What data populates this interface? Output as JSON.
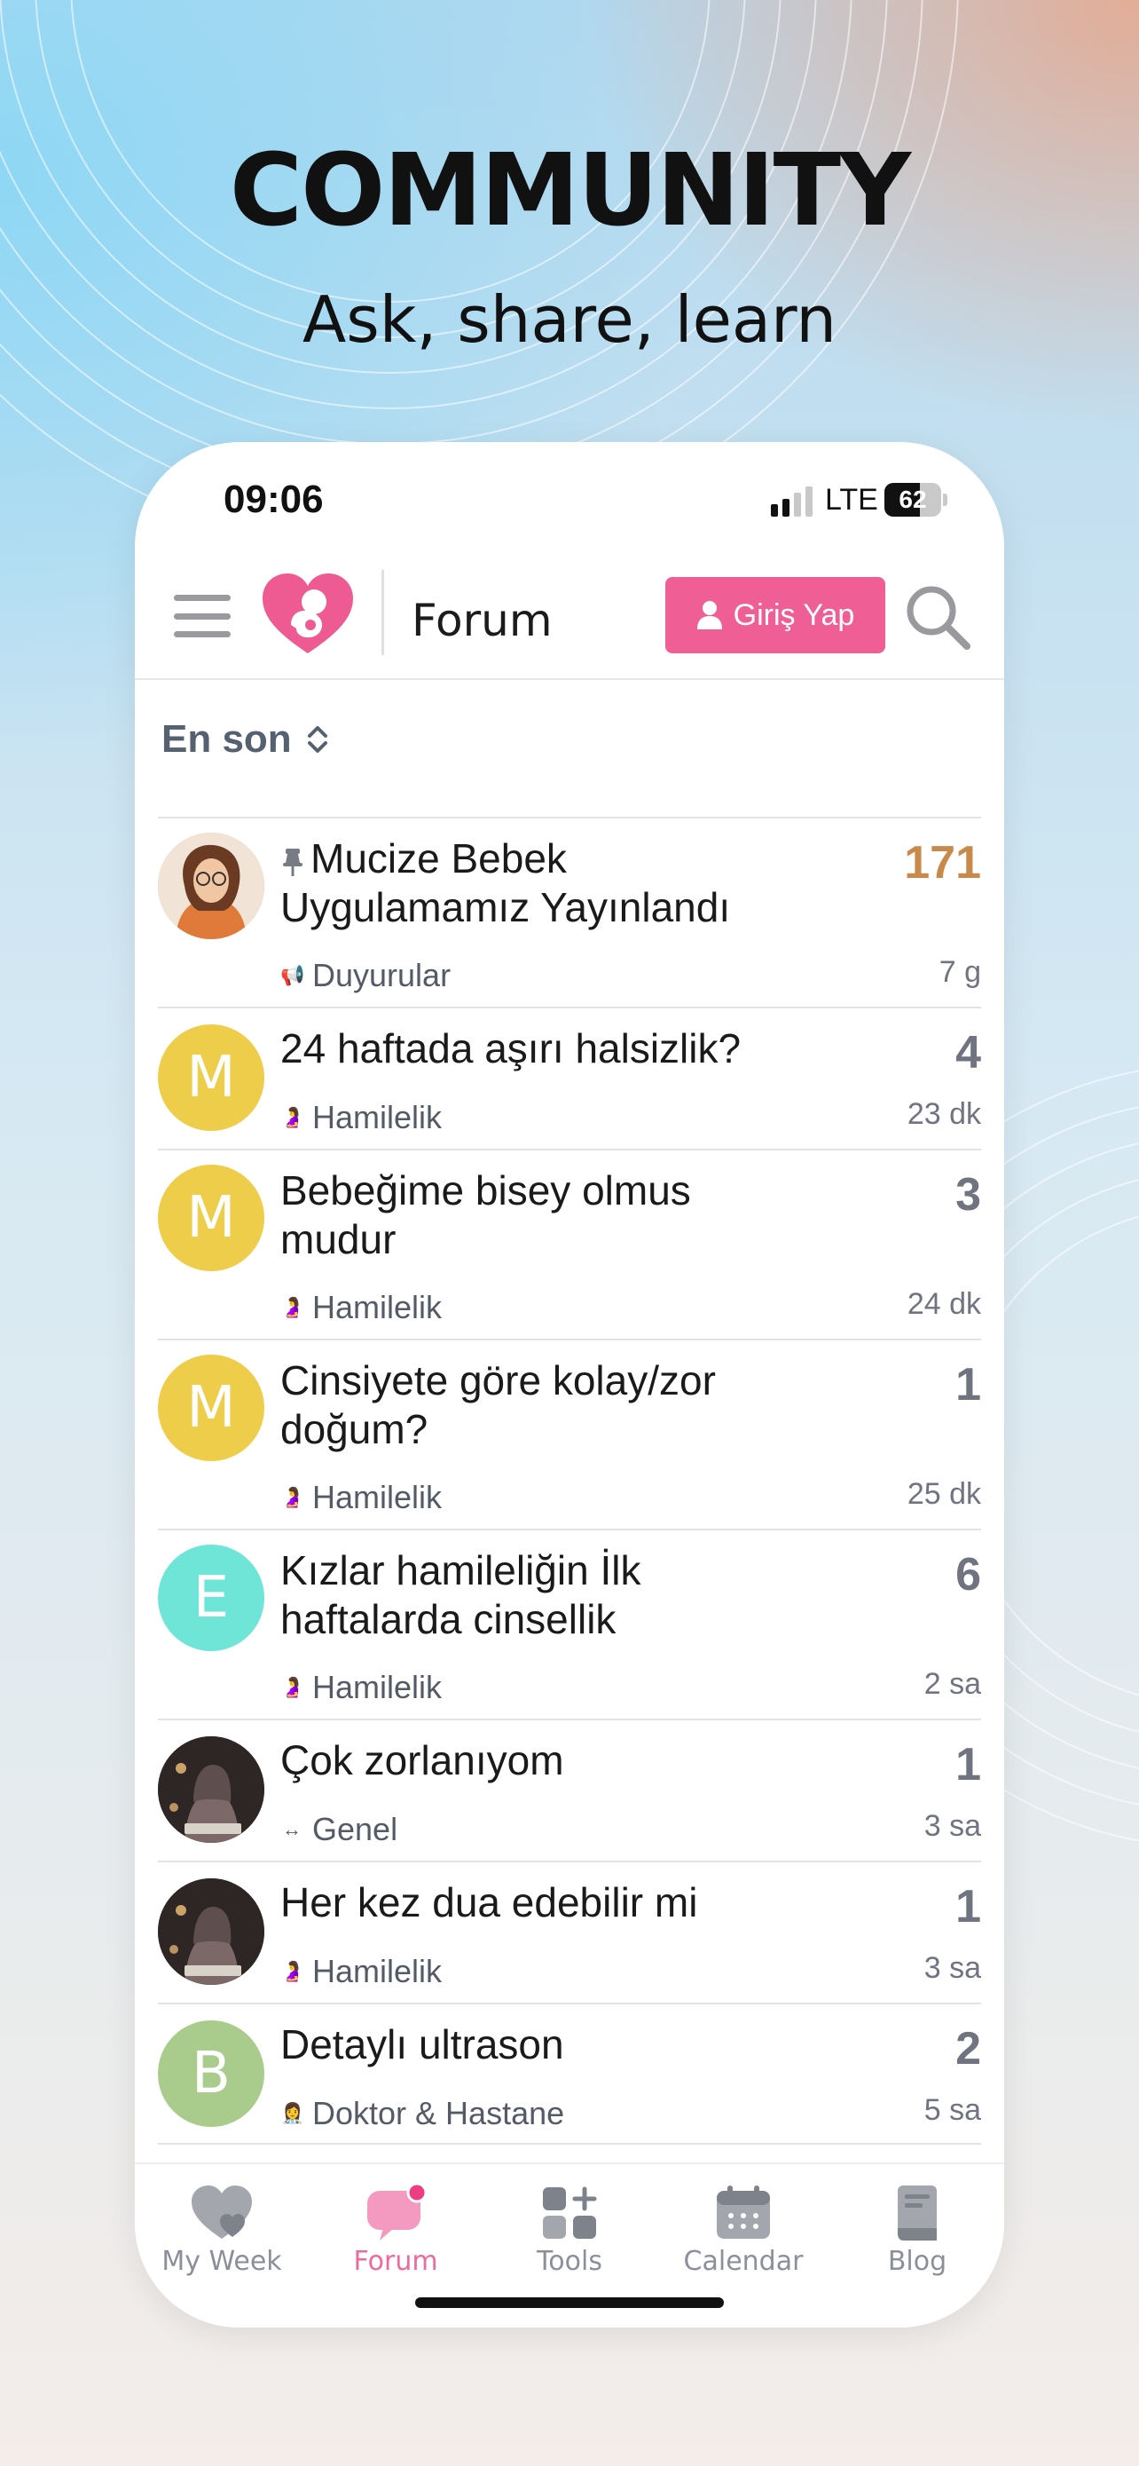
{
  "promo": {
    "headline": "COMMUNITY",
    "subline": "Ask, share, learn"
  },
  "status_bar": {
    "time": "09:06",
    "network": "LTE",
    "battery": "62",
    "battery_level": 0.62,
    "signal_bars_filled": 2,
    "signal_bars_total": 4
  },
  "app_bar": {
    "title": "Forum",
    "login_label": "Giriş Yap",
    "icons": [
      "hamburger-menu-icon",
      "heart-baby-logo",
      "user-icon",
      "search-icon"
    ]
  },
  "sort": {
    "label": "En son",
    "icon": "sort-updown-icon"
  },
  "topics": [
    {
      "avatar_type": "photo",
      "avatar_letter": "",
      "avatar_color": "#d9a07a",
      "pinned": true,
      "title": "Mucize Bebek Uygulamamız Yayınlandı",
      "category": "Duyurular",
      "category_icon": "📢",
      "count": "171",
      "age": "7 g",
      "hot": true
    },
    {
      "avatar_type": "letter",
      "avatar_letter": "M",
      "avatar_color": "#eecd4b",
      "pinned": false,
      "title": "24 haftada aşırı halsizlik?",
      "category": "Hamilelik",
      "category_icon": "🤰",
      "count": "4",
      "age": "23 dk",
      "hot": false
    },
    {
      "avatar_type": "letter",
      "avatar_letter": "M",
      "avatar_color": "#eecd4b",
      "pinned": false,
      "title": "Bebeğime bisey olmus mudur",
      "category": "Hamilelik",
      "category_icon": "🤰",
      "count": "3",
      "age": "24 dk",
      "hot": false
    },
    {
      "avatar_type": "letter",
      "avatar_letter": "M",
      "avatar_color": "#eecd4b",
      "pinned": false,
      "title": "Cinsiyete göre kolay/zor doğum?",
      "category": "Hamilelik",
      "category_icon": "🤰",
      "count": "1",
      "age": "25 dk",
      "hot": false
    },
    {
      "avatar_type": "letter",
      "avatar_letter": "E",
      "avatar_color": "#6fe5d8",
      "pinned": false,
      "title": "Kızlar hamileliğin İlk haftalarda cinsellik",
      "category": "Hamilelik",
      "category_icon": "🤰",
      "count": "6",
      "age": "2 sa",
      "hot": false
    },
    {
      "avatar_type": "photo",
      "avatar_letter": "",
      "avatar_color": "#5a4a4a",
      "pinned": false,
      "title": "Çok zorlanıyom",
      "category": "Genel",
      "category_icon": "↔",
      "count": "1",
      "age": "3 sa",
      "hot": false
    },
    {
      "avatar_type": "photo",
      "avatar_letter": "",
      "avatar_color": "#5a4a4a",
      "pinned": false,
      "title": "Her kez dua edebilir mi",
      "category": "Hamilelik",
      "category_icon": "🤰",
      "count": "1",
      "age": "3 sa",
      "hot": false
    },
    {
      "avatar_type": "letter",
      "avatar_letter": "B",
      "avatar_color": "#a9cc8c",
      "pinned": false,
      "title": "Detaylı ultrason",
      "category": "Doktor & Hastane",
      "category_icon": "👩‍⚕️",
      "count": "2",
      "age": "5 sa",
      "hot": false
    }
  ],
  "tabs": [
    {
      "label": "My Week",
      "icon": "heart-icon",
      "active": false
    },
    {
      "label": "Forum",
      "icon": "chat-bubble-icon",
      "active": true
    },
    {
      "label": "Tools",
      "icon": "tools-grid-icon",
      "active": false
    },
    {
      "label": "Calendar",
      "icon": "calendar-icon",
      "active": false
    },
    {
      "label": "Blog",
      "icon": "book-icon",
      "active": false
    }
  ],
  "colors": {
    "accent": "#ef5f95",
    "hot_count": "#c9894b",
    "tab_active": "#ee6a9d"
  }
}
